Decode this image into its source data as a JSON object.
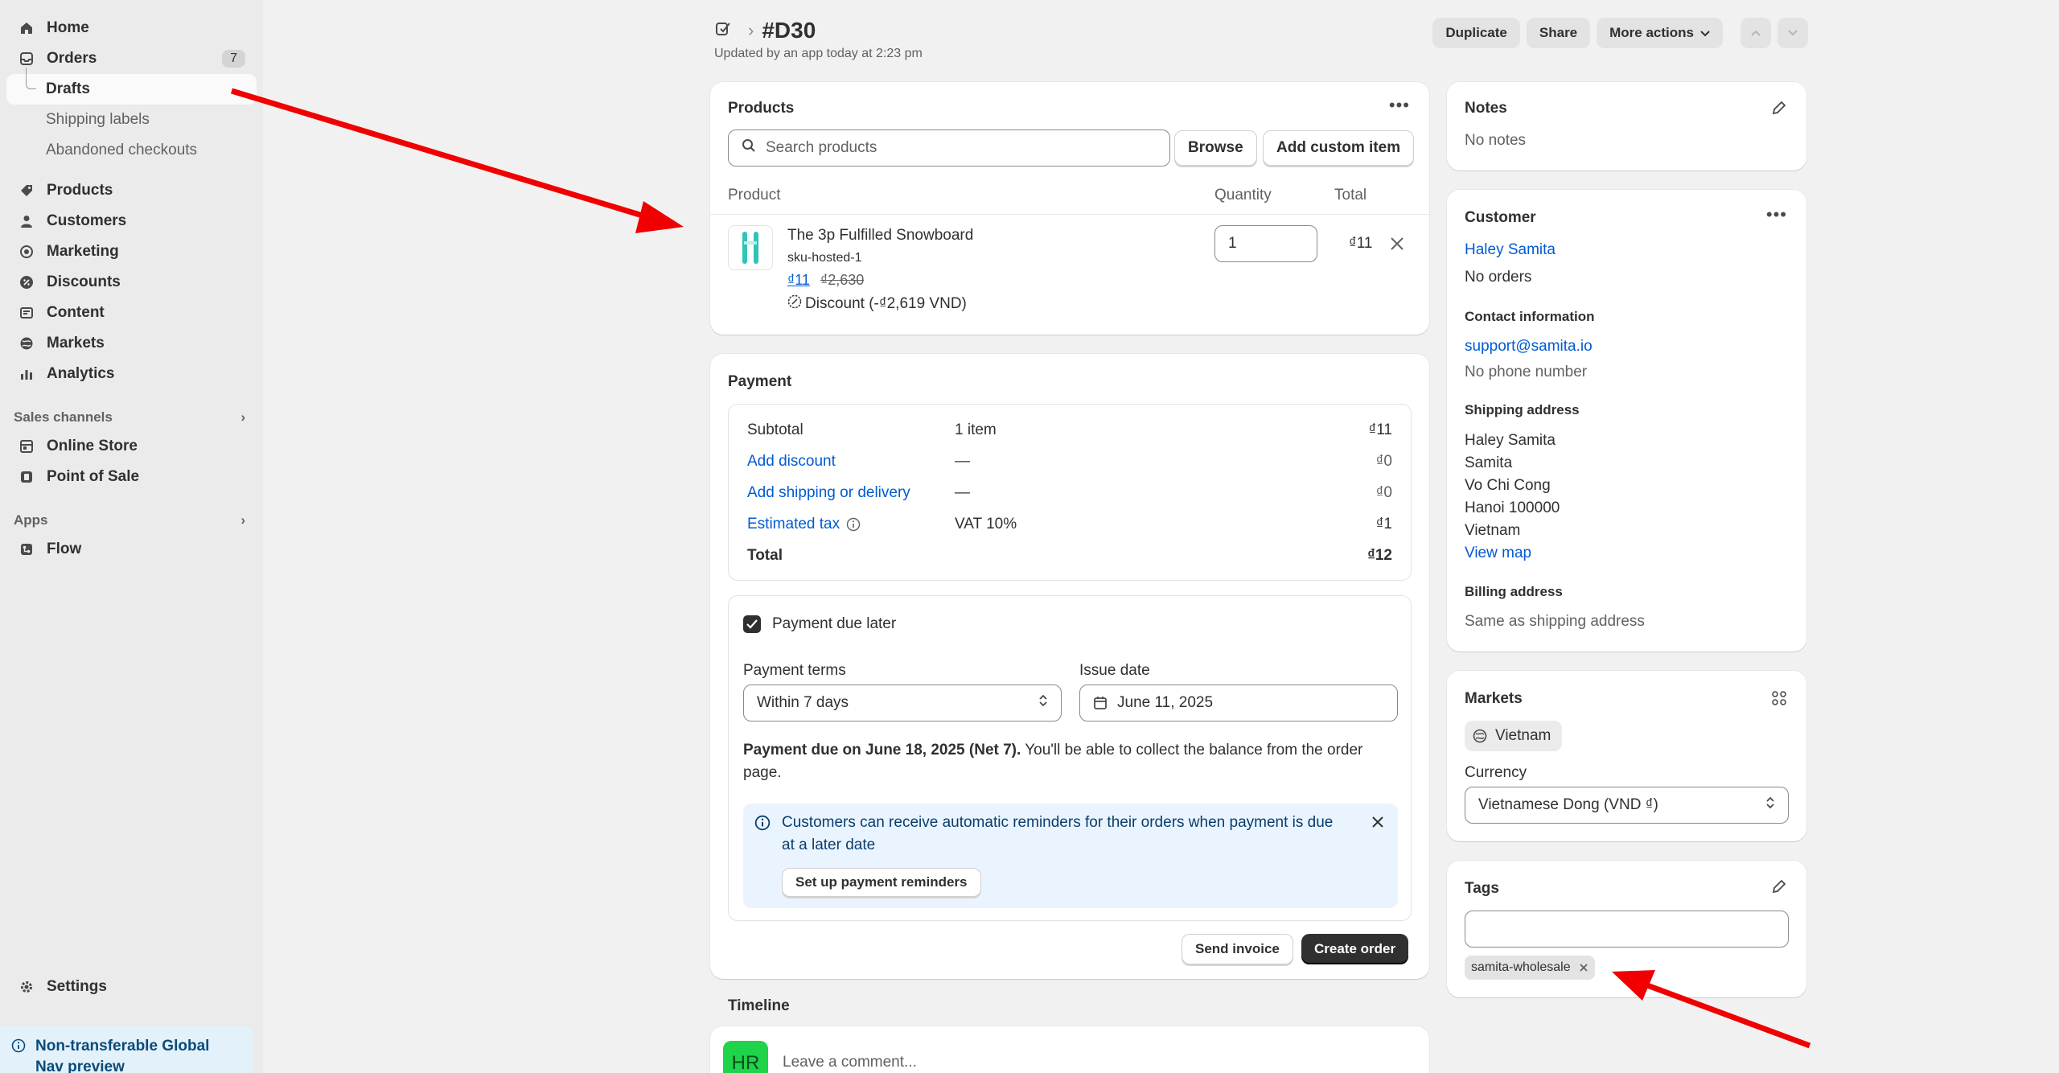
{
  "sidebar": {
    "items": [
      {
        "label": "Home",
        "icon": "home-icon"
      },
      {
        "label": "Orders",
        "icon": "inbox-icon",
        "badge": "7"
      },
      {
        "label": "Products",
        "icon": "tag-icon"
      },
      {
        "label": "Customers",
        "icon": "person-icon"
      },
      {
        "label": "Marketing",
        "icon": "target-icon"
      },
      {
        "label": "Discounts",
        "icon": "discount-icon"
      },
      {
        "label": "Content",
        "icon": "content-icon"
      },
      {
        "label": "Markets",
        "icon": "globe-icon"
      },
      {
        "label": "Analytics",
        "icon": "chart-bar-icon"
      }
    ],
    "order_subitems": [
      "Drafts",
      "Shipping labels",
      "Abandoned checkouts"
    ],
    "sales_channels_label": "Sales channels",
    "sales_channels": [
      "Online Store",
      "Point of Sale"
    ],
    "apps_label": "Apps",
    "apps": [
      "Flow"
    ],
    "settings_label": "Settings",
    "banner_text": "Non-transferable Global Nav preview"
  },
  "header": {
    "title": "#D30",
    "subtitle": "Updated by an app today at 2:23 pm",
    "duplicate": "Duplicate",
    "share": "Share",
    "more_actions": "More actions"
  },
  "products": {
    "title": "Products",
    "search_placeholder": "Search products",
    "browse": "Browse",
    "add_custom": "Add custom item",
    "col_product": "Product",
    "col_quantity": "Quantity",
    "col_total": "Total",
    "item": {
      "name": "The 3p Fulfilled Snowboard",
      "sku": "sku-hosted-1",
      "price": "₫11",
      "original_price": "₫2,630",
      "discount": "Discount (-₫2,619 VND)",
      "quantity": "1",
      "total": "₫11"
    }
  },
  "payment": {
    "title": "Payment",
    "rows": [
      {
        "label": "Subtotal",
        "mid": "1 item",
        "value": "₫11",
        "link": false
      },
      {
        "label": "Add discount",
        "mid": "—",
        "value": "₫0",
        "link": true
      },
      {
        "label": "Add shipping or delivery",
        "mid": "—",
        "value": "₫0",
        "link": true
      },
      {
        "label": "Estimated tax",
        "mid": "VAT 10%",
        "value": "₫1",
        "link": true
      }
    ],
    "total_label": "Total",
    "total_value": "₫12",
    "due_later_label": "Payment due later",
    "terms_label": "Payment terms",
    "terms_value": "Within 7 days",
    "issue_label": "Issue date",
    "issue_value": "June 11, 2025",
    "due_strong": "Payment due on June 18, 2025 (Net 7).",
    "due_rest": " You'll be able to collect the balance from the order page.",
    "banner_text": "Customers can receive automatic reminders for their orders when payment is due at a later date",
    "banner_button": "Set up payment reminders",
    "send_invoice": "Send invoice",
    "create_order": "Create order"
  },
  "timeline": {
    "title": "Timeline",
    "avatar": "HR",
    "comment_placeholder": "Leave a comment..."
  },
  "notes": {
    "title": "Notes",
    "value": "No notes"
  },
  "customer": {
    "title": "Customer",
    "name": "Haley Samita",
    "orders": "No orders",
    "contact_label": "Contact information",
    "email": "support@samita.io",
    "phone": "No phone number",
    "shipping_label": "Shipping address",
    "shipping_lines": [
      "Haley Samita",
      "Samita",
      "Vo Chi Cong",
      "Hanoi 100000",
      "Vietnam"
    ],
    "view_map": "View map",
    "billing_label": "Billing address",
    "billing_value": "Same as shipping address"
  },
  "markets": {
    "title": "Markets",
    "market": "Vietnam",
    "currency_label": "Currency",
    "currency_value": "Vietnamese Dong (VND ₫)"
  },
  "tags": {
    "title": "Tags",
    "tag": "samita-wholesale"
  },
  "colors": {
    "arrow": "#f00000",
    "link": "#005bd3",
    "avatar_bg": "#1fd34a"
  }
}
